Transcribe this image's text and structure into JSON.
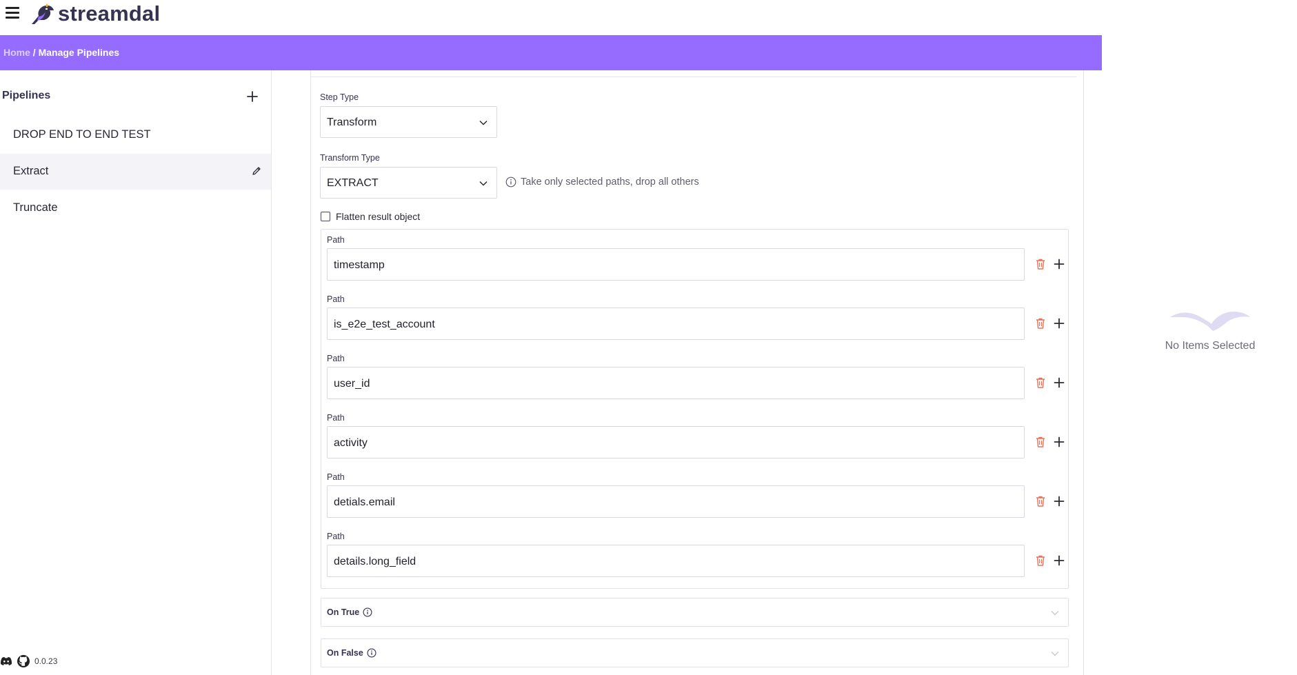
{
  "brand": {
    "name": "streamdal",
    "accent": "#956cff"
  },
  "breadcrumb": {
    "home": "Home",
    "separator": " / ",
    "current": "Manage Pipelines"
  },
  "sidebar": {
    "title": "Pipelines",
    "items": [
      {
        "label": "DROP END TO END TEST",
        "active": false
      },
      {
        "label": "Extract",
        "active": true
      },
      {
        "label": "Truncate",
        "active": false
      }
    ],
    "version": "0.0.23"
  },
  "step": {
    "step_type_label": "Step Type",
    "step_type_value": "Transform",
    "transform_type_label": "Transform Type",
    "transform_type_value": "EXTRACT",
    "transform_hint": "Take only selected paths, drop all others",
    "flatten_label": "Flatten result object",
    "flatten_checked": false,
    "path_label": "Path",
    "paths": [
      "timestamp",
      "is_e2e_test_account",
      "user_id",
      "activity",
      "detials.email",
      "details.long_field"
    ],
    "on_true_label": "On True",
    "on_false_label": "On False"
  },
  "details_panel": {
    "empty_text": "No Items Selected"
  },
  "icons": {
    "menu": "hamburger-menu-icon",
    "add": "plus-icon",
    "edit": "pencil-icon",
    "chevron": "chevron-down-icon",
    "info": "info-icon",
    "delete": "trash-icon",
    "discord": "discord-icon",
    "github": "github-icon"
  }
}
